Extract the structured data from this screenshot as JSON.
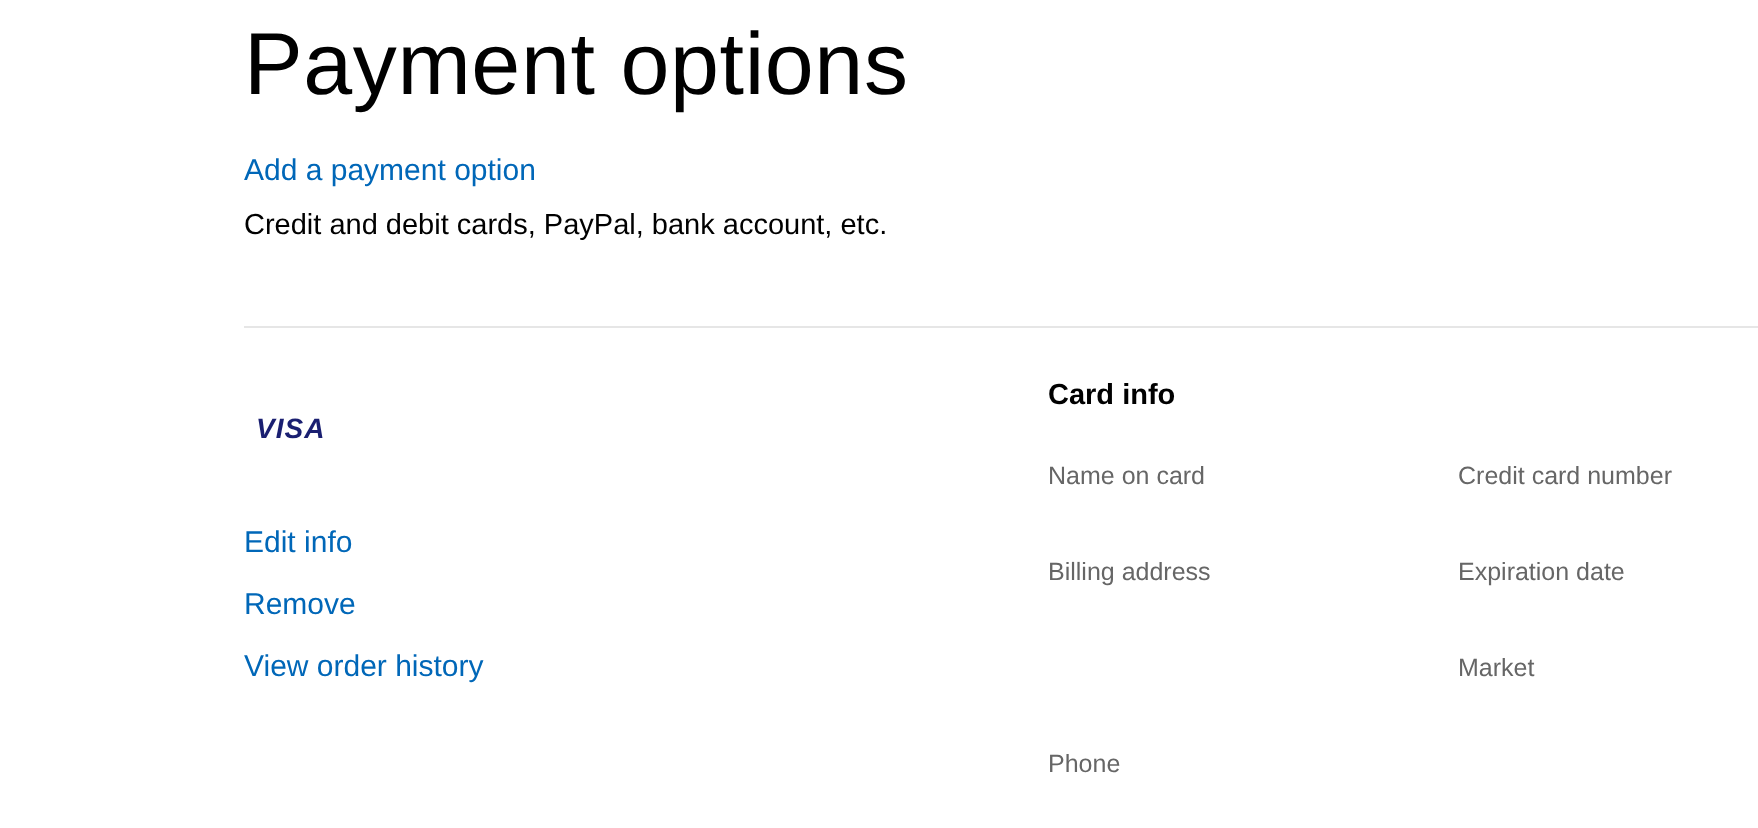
{
  "page": {
    "title": "Payment options"
  },
  "add_link": "Add a payment option",
  "description": "Credit and debit cards, PayPal, bank account, etc.",
  "card": {
    "brand": "VISA",
    "actions": [
      "Edit info",
      "Remove",
      "View order history"
    ]
  },
  "card_info": {
    "heading": "Card info",
    "rows": [
      {
        "left": "Name on card",
        "right": "Credit card number"
      },
      {
        "left": "Billing address",
        "right": "Expiration date"
      },
      {
        "right": "Market"
      },
      {
        "left": "Phone"
      }
    ]
  }
}
